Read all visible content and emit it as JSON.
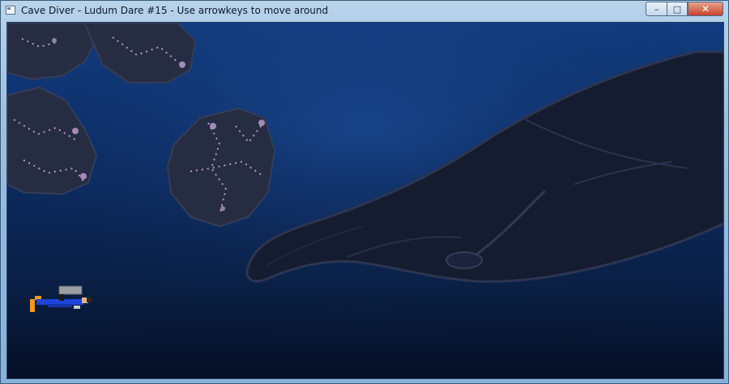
{
  "window": {
    "title": "Cave Diver - Ludum Dare #15 - Use arrowkeys to move around",
    "controls": {
      "minimize": "–",
      "maximize": "□",
      "close": "✕"
    }
  },
  "scene": {
    "background_top": "#123f86",
    "background_bottom": "#060f26",
    "rock_color": "#2a2f44",
    "crystal_color": "#c3a3d6",
    "whale_color": "#161c2f",
    "player_colors": {
      "suit": "#1e45d8",
      "tank": "#9a9fa6",
      "fins": "#f09a1a",
      "skin": "#e3b48a"
    }
  }
}
